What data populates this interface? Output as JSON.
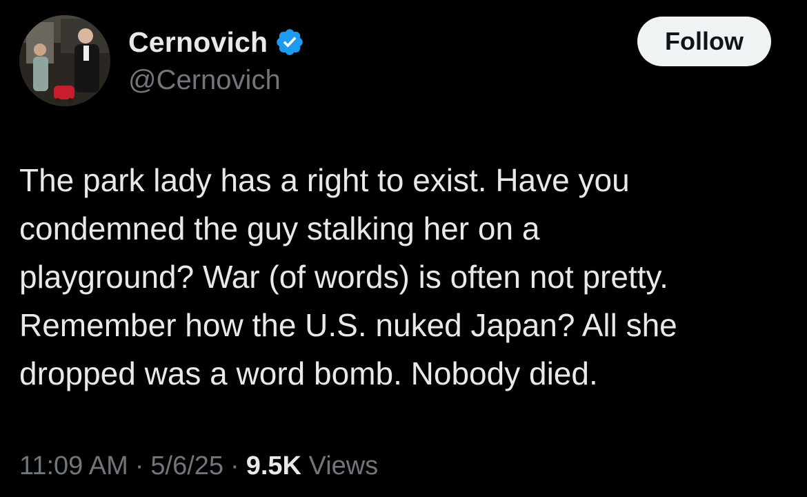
{
  "author": {
    "display_name": "Cernovich",
    "handle": "@Cernovich",
    "verified_icon": "verified-badge-icon",
    "verified_color": "#1d9bf0"
  },
  "follow_button": {
    "label": "Follow"
  },
  "tweet": {
    "lines": [
      "The park lady has a right to exist. Have you",
      "condemned the guy stalking her on a",
      "playground? War (of words) is often not pretty.",
      "Remember how the U.S. nuked Japan? All she",
      "dropped was a word bomb. Nobody died."
    ]
  },
  "meta": {
    "time": "11:09 AM",
    "separator": "·",
    "date": "5/6/25",
    "views_count": "9.5K",
    "views_label": "Views"
  },
  "colors": {
    "background": "#000000",
    "primary_text": "#e7e9ea",
    "secondary_text": "#71767b",
    "button_bg": "#eff3f4"
  }
}
